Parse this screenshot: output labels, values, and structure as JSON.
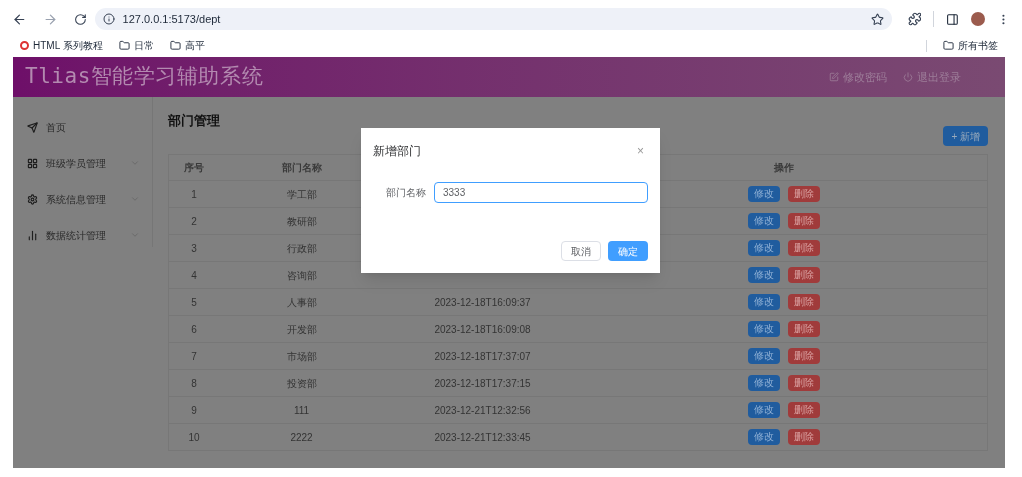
{
  "browser": {
    "url": "127.0.0.1:5173/dept",
    "bookmarks": [
      {
        "kind": "site",
        "label": "HTML 系列教程"
      },
      {
        "kind": "folder",
        "label": "日常"
      },
      {
        "kind": "folder",
        "label": "高平"
      }
    ],
    "all_bookmarks": "所有书签"
  },
  "header": {
    "title": "Tlias智能学习辅助系统",
    "links": [
      {
        "kind": "edit",
        "label": "修改密码"
      },
      {
        "kind": "logout",
        "label": "退出登录"
      }
    ]
  },
  "sidebar": {
    "items": [
      {
        "kind": "home",
        "label": "首页"
      },
      {
        "kind": "grid",
        "label": "班级学员管理",
        "expanded": false
      },
      {
        "kind": "gear",
        "label": "系统信息管理",
        "expanded": false
      },
      {
        "kind": "chart",
        "label": "数据统计管理",
        "expanded": false
      }
    ]
  },
  "page": {
    "title": "部门管理",
    "add_button": "+ 新增"
  },
  "table": {
    "columns": [
      "序号",
      "部门名称",
      "操作"
    ],
    "rows": [
      {
        "index": "1",
        "name": "学工部",
        "actions": [
          "修改",
          "删除"
        ]
      },
      {
        "index": "2",
        "name": "教研部",
        "actions": [
          "修改",
          "删除"
        ]
      },
      {
        "index": "3",
        "name": "行政部",
        "actions": [
          "修改",
          "删除"
        ]
      },
      {
        "index": "4",
        "name": "咨询部",
        "actions": [
          "修改",
          "删除"
        ]
      },
      {
        "index": "5",
        "name": "人事部",
        "time": "2023-12-18T16:09:37",
        "actions": [
          "修改",
          "删除"
        ]
      },
      {
        "index": "6",
        "name": "开发部",
        "time": "2023-12-18T16:09:08",
        "actions": [
          "修改",
          "删除"
        ]
      },
      {
        "index": "7",
        "name": "市场部",
        "time": "2023-12-18T17:37:07",
        "actions": [
          "修改",
          "删除"
        ]
      },
      {
        "index": "8",
        "name": "投资部",
        "time": "2023-12-18T17:37:15",
        "actions": [
          "修改",
          "删除"
        ]
      },
      {
        "index": "9",
        "name": "111",
        "time": "2023-12-21T12:32:56",
        "actions": [
          "修改",
          "删除"
        ]
      },
      {
        "index": "10",
        "name": "2222",
        "time": "2023-12-21T12:33:45",
        "actions": [
          "修改",
          "删除"
        ]
      }
    ]
  },
  "dialog": {
    "title": "新增部门",
    "close": "×",
    "field": {
      "label": "部门名称",
      "value": "3333",
      "focused": true
    },
    "buttons": [
      {
        "kind": "cancel",
        "label": "取消"
      },
      {
        "kind": "primary",
        "label": "确定"
      }
    ]
  }
}
